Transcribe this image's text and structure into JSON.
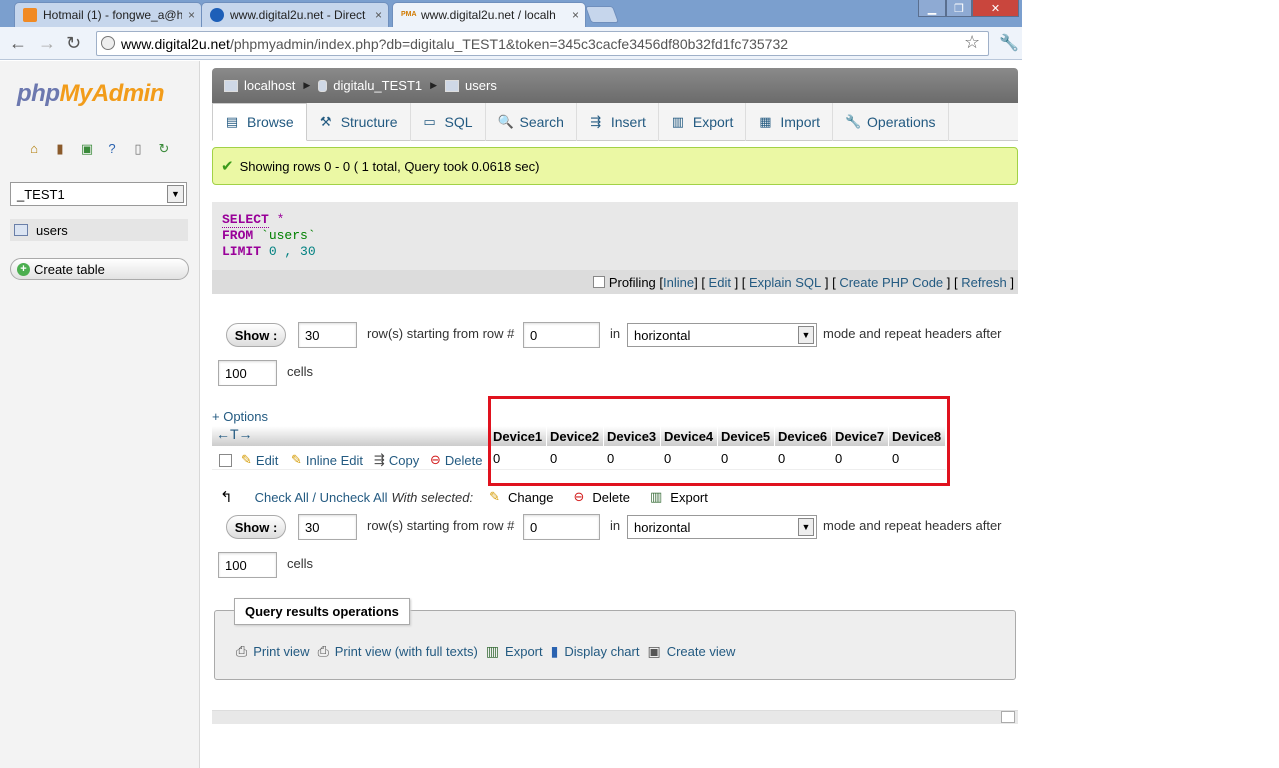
{
  "browser": {
    "tabs": [
      {
        "title": "Hotmail (1) - fongwe_a@h",
        "close": "×"
      },
      {
        "title": "www.digital2u.net - Direct",
        "close": "×"
      },
      {
        "title": "www.digital2u.net / localh",
        "close": "×",
        "favicon_text": "PMA"
      }
    ],
    "url_domain": "www.digital2u.net",
    "url_path": "/phpmyadmin/index.php?db=digitalu_TEST1&token=345c3cacfe3456df80b32fd1fc735732"
  },
  "sidebar": {
    "logo_php": "php",
    "logo_myadmin": "MyAdmin",
    "db_selected": "_TEST1",
    "table": "users",
    "create_table": "Create table"
  },
  "breadcrumb": {
    "server": "localhost",
    "database": "digitalu_TEST1",
    "table": "users"
  },
  "tabs": [
    "Browse",
    "Structure",
    "SQL",
    "Search",
    "Insert",
    "Export",
    "Import",
    "Operations"
  ],
  "message": "Showing rows 0 - 0 ( 1 total, Query took 0.0618 sec)",
  "sql": {
    "select_kw": "SELECT",
    "select_rest": "*",
    "from_kw": "FROM",
    "from_rest": "`users`",
    "limit_kw": "LIMIT",
    "limit_rest": "0 , 30"
  },
  "sql_links": {
    "profiling": "Profiling",
    "inline": "Inline",
    "edit": "Edit",
    "explain": "Explain SQL",
    "php": "Create PHP Code",
    "refresh": "Refresh"
  },
  "nav": {
    "show": "Show :",
    "rows": "30",
    "rows_label": "row(s) starting from row #",
    "start": "0",
    "in_label": "in",
    "mode": "horizontal",
    "mode_label": "mode and repeat headers after",
    "repeat": "100",
    "cells": "cells"
  },
  "options_link": "+ Options",
  "col_arrows": "←T→",
  "columns": [
    "Device1",
    "Device2",
    "Device3",
    "Device4",
    "Device5",
    "Device6",
    "Device7",
    "Device8"
  ],
  "row": {
    "values": [
      "0",
      "0",
      "0",
      "0",
      "0",
      "0",
      "0",
      "0"
    ],
    "edit": "Edit",
    "inline_edit": "Inline Edit",
    "copy": "Copy",
    "delete": "Delete"
  },
  "with_selected": {
    "check_all": "Check All / Uncheck All",
    "label": "With selected:",
    "change": "Change",
    "delete": "Delete",
    "export": "Export"
  },
  "qro": {
    "title": "Query results operations",
    "print": "Print view",
    "print_full": "Print view (with full texts)",
    "export": "Export",
    "chart": "Display chart",
    "create_view": "Create view"
  },
  "colors": {
    "link": "#235a81",
    "success_bg": "#ebf8a4",
    "highlight": "#e0121e",
    "sql_keyword": "#990099"
  }
}
